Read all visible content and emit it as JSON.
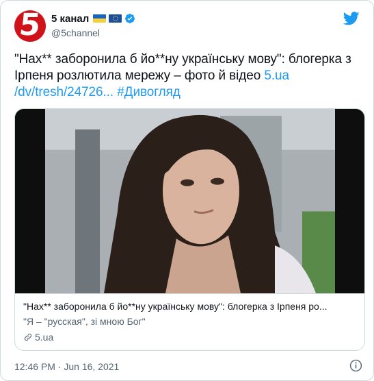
{
  "author": {
    "name": "5 канал",
    "handle": "@5channel",
    "avatar_text": "5",
    "avatar_color": "#d0121b",
    "flags": [
      "ukraine-flag",
      "eu-flag"
    ],
    "verified": true
  },
  "tweet": {
    "text_main": "\"Нах** заборонила б йо**ну українську мову\": блогерка з Ірпеня розлютила мережу – фото й відео ",
    "link_text": "5.ua /dv/tresh/24726...",
    "hashtag": "#Дивогляд"
  },
  "card": {
    "title": "\"Нах** заборонила б йо**ну українську мову\": блогерка з Ірпеня ро...",
    "description": "\"Я – \"русская\", зі мною Бог\"",
    "domain": "5.ua"
  },
  "footer": {
    "timestamp": "12:46 PM · Jun 16, 2021"
  },
  "colors": {
    "accent": "#1d9bf0",
    "secondary_text": "#536471",
    "border": "#cfd9de"
  }
}
